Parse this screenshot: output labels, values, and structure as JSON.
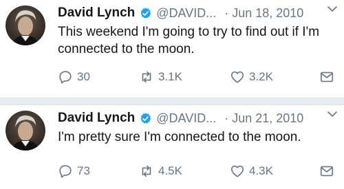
{
  "colors": {
    "verified": "#1da1f2",
    "secondary_text": "#657786",
    "primary_text": "#14171a",
    "divider": "#e6ecf0"
  },
  "tweets": [
    {
      "name": "David Lynch",
      "handle": "@DAVID...",
      "date": "· Jun 18, 2010",
      "text": "This weekend I'm going to try to find out if I'm connected to the moon.",
      "replies": "30",
      "retweets": "3.1K",
      "likes": "3.2K",
      "icons": [
        "avatar",
        "verified-badge-icon",
        "chevron-down-icon",
        "reply-icon",
        "retweet-icon",
        "like-icon",
        "message-icon"
      ]
    },
    {
      "name": "David Lynch",
      "handle": "@DAVID...",
      "date": "· Jun 21, 2010",
      "text": "I'm pretty sure I'm connected to the moon.",
      "replies": "73",
      "retweets": "4.5K",
      "likes": "4.3K",
      "icons": [
        "avatar",
        "verified-badge-icon",
        "chevron-down-icon",
        "reply-icon",
        "retweet-icon",
        "like-icon",
        "message-icon"
      ]
    }
  ]
}
